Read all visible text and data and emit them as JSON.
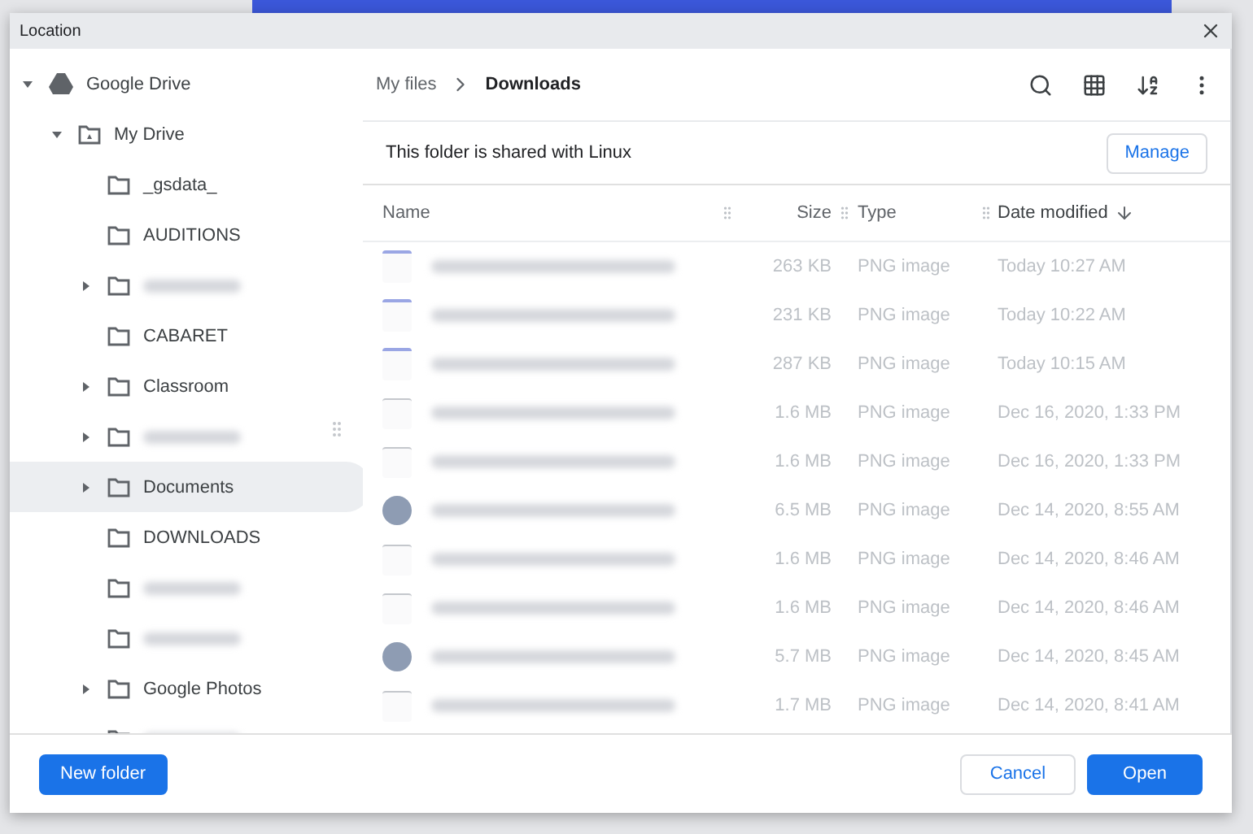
{
  "window": {
    "title": "Location"
  },
  "sidebar": {
    "tree": [
      {
        "label": "Google Drive",
        "kind": "drive",
        "expanded": true,
        "children": [
          {
            "label": "My Drive",
            "kind": "mydrive",
            "expanded": true,
            "children": [
              {
                "label": "_gsdata_",
                "kind": "folder",
                "expandable": false,
                "selected": false,
                "redacted": false
              },
              {
                "label": "AUDITIONS",
                "kind": "folder",
                "expandable": false,
                "selected": false,
                "redacted": false
              },
              {
                "kind": "folder",
                "expandable": true,
                "selected": false,
                "redacted": true
              },
              {
                "label": "CABARET",
                "kind": "folder",
                "expandable": false,
                "selected": false,
                "redacted": false
              },
              {
                "label": "Classroom",
                "kind": "folder",
                "expandable": true,
                "selected": false,
                "redacted": false
              },
              {
                "kind": "folder",
                "expandable": true,
                "selected": false,
                "redacted": true
              },
              {
                "label": "Documents",
                "kind": "folder",
                "expandable": true,
                "selected": true,
                "redacted": false
              },
              {
                "label": "DOWNLOADS",
                "kind": "folder",
                "expandable": false,
                "selected": false,
                "redacted": false
              },
              {
                "kind": "folder",
                "expandable": false,
                "selected": false,
                "redacted": true
              },
              {
                "kind": "folder",
                "expandable": false,
                "selected": false,
                "redacted": true
              },
              {
                "label": "Google Photos",
                "kind": "folder",
                "expandable": true,
                "selected": false,
                "redacted": false
              },
              {
                "kind": "folder",
                "selected": false,
                "redacted": true
              }
            ]
          }
        ]
      }
    ]
  },
  "breadcrumb": [
    {
      "label": "My files",
      "selected": false
    },
    {
      "label": "Downloads",
      "selected": true
    }
  ],
  "banner": {
    "text": "This folder is shared with Linux",
    "button": "Manage"
  },
  "table": {
    "columns": [
      {
        "label": "Name",
        "sorted": false
      },
      {
        "label": "Size",
        "sorted": false
      },
      {
        "label": "Type",
        "sorted": false
      },
      {
        "label": "Date modified",
        "sorted": true
      }
    ],
    "rows": [
      {
        "kind": "doc",
        "size": "263 KB",
        "type": "PNG image",
        "date": "Today 10:27 AM",
        "disabled": true
      },
      {
        "kind": "doc",
        "size": "231 KB",
        "type": "PNG image",
        "date": "Today 10:22 AM",
        "disabled": true
      },
      {
        "kind": "doc",
        "size": "287 KB",
        "type": "PNG image",
        "date": "Today 10:15 AM",
        "disabled": true
      },
      {
        "kind": "page",
        "size": "1.6 MB",
        "type": "PNG image",
        "date": "Dec 16, 2020, 1:33 PM",
        "disabled": true
      },
      {
        "kind": "page",
        "size": "1.6 MB",
        "type": "PNG image",
        "date": "Dec 16, 2020, 1:33 PM",
        "disabled": true
      },
      {
        "kind": "photo",
        "size": "6.5 MB",
        "type": "PNG image",
        "date": "Dec 14, 2020, 8:55 AM",
        "disabled": true
      },
      {
        "kind": "page",
        "size": "1.6 MB",
        "type": "PNG image",
        "date": "Dec 14, 2020, 8:46 AM",
        "disabled": true
      },
      {
        "kind": "page",
        "size": "1.6 MB",
        "type": "PNG image",
        "date": "Dec 14, 2020, 8:46 AM",
        "disabled": true
      },
      {
        "kind": "photo",
        "size": "5.7 MB",
        "type": "PNG image",
        "date": "Dec 14, 2020, 8:45 AM",
        "disabled": true
      },
      {
        "kind": "page",
        "size": "1.7 MB",
        "type": "PNG image",
        "date": "Dec 14, 2020, 8:41 AM",
        "disabled": true
      }
    ]
  },
  "footer": {
    "left_button": "New folder",
    "buttons": [
      {
        "label": "Cancel",
        "kind": "secondary"
      },
      {
        "label": "Open",
        "kind": "primary"
      }
    ]
  }
}
